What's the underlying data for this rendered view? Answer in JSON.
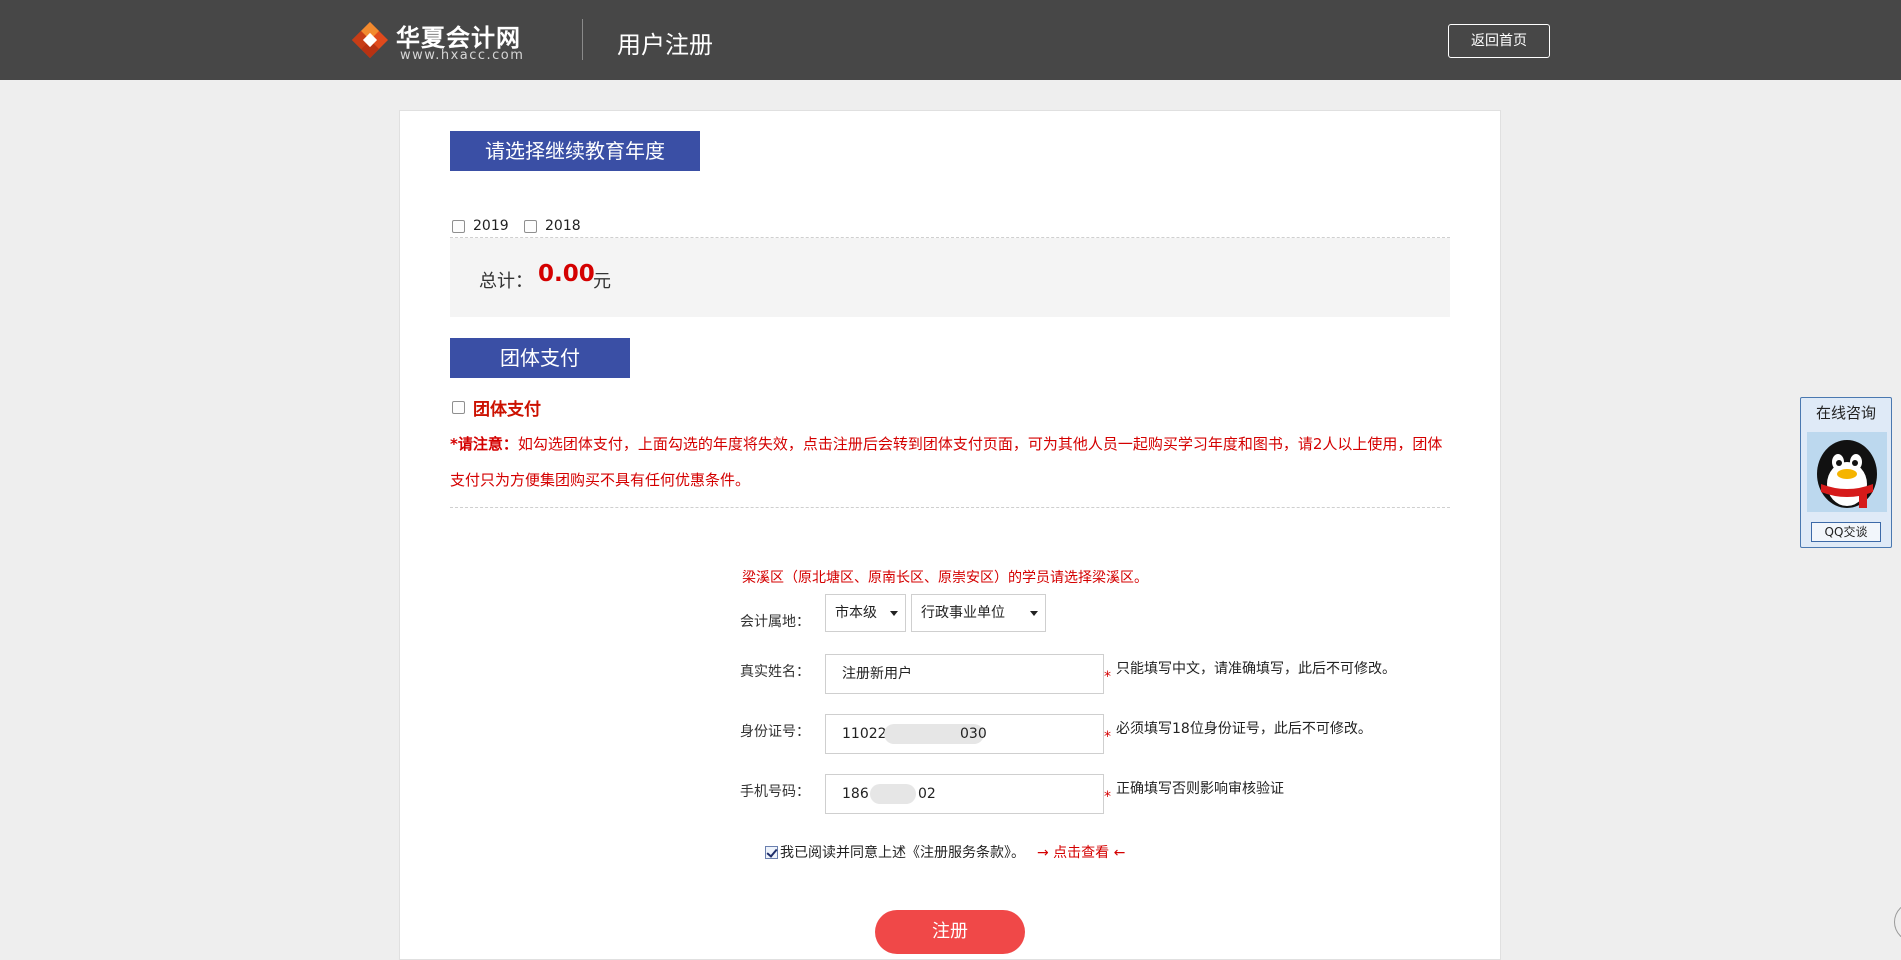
{
  "header": {
    "logo_name": "华夏会计网",
    "logo_url": "www.hxacc.com",
    "page_title": "用户注册",
    "home_button": "返回首页"
  },
  "year_section": {
    "heading": "请选择继续教育年度",
    "years": [
      "2019",
      "2018"
    ],
    "total_label": "总计：",
    "total_value": "0.00",
    "total_unit": "元"
  },
  "group_section": {
    "heading": "团体支付",
    "checkbox_label": "团体支付",
    "notice_prefix": "*请注意：",
    "notice_text": "如勾选团体支付，上面勾选的年度将失效，点击注册后会转到团体支付页面，可为其他人员一起购买学习年度和图书，请2人以上使用，团体支付只为方便集团购买不具有任何优惠条件。"
  },
  "form": {
    "district_note": "梁溪区（原北塘区、原南长区、原崇安区）的学员请选择梁溪区。",
    "accounting_location": {
      "label": "会计属地：",
      "level": "市本级",
      "unit_type": "行政事业单位"
    },
    "real_name": {
      "label": "真实姓名：",
      "value": "注册新用户",
      "hint": "只能填写中文，请准确填写，此后不可修改。"
    },
    "id_number": {
      "label": "身份证号：",
      "value_visible_start": "11022",
      "value_visible_end": "030",
      "hint": "必须填写18位身份证号，此后不可修改。"
    },
    "phone": {
      "label": "手机号码：",
      "value_visible_start": "186",
      "value_visible_end": "02",
      "hint": "正确填写否则影响审核验证"
    },
    "required_mark": "*",
    "agree_text": "我已阅读并同意上述《注册服务条款》。",
    "view_link": "→ 点击查看 ←",
    "submit": "注册"
  },
  "qq_widget": {
    "title": "在线咨询",
    "button": "QQ交谈"
  },
  "colors": {
    "header_bg": "#474747",
    "section_heading_bg": "#3a4fa5",
    "accent_red": "#d40000",
    "register_button": "#f04848"
  }
}
